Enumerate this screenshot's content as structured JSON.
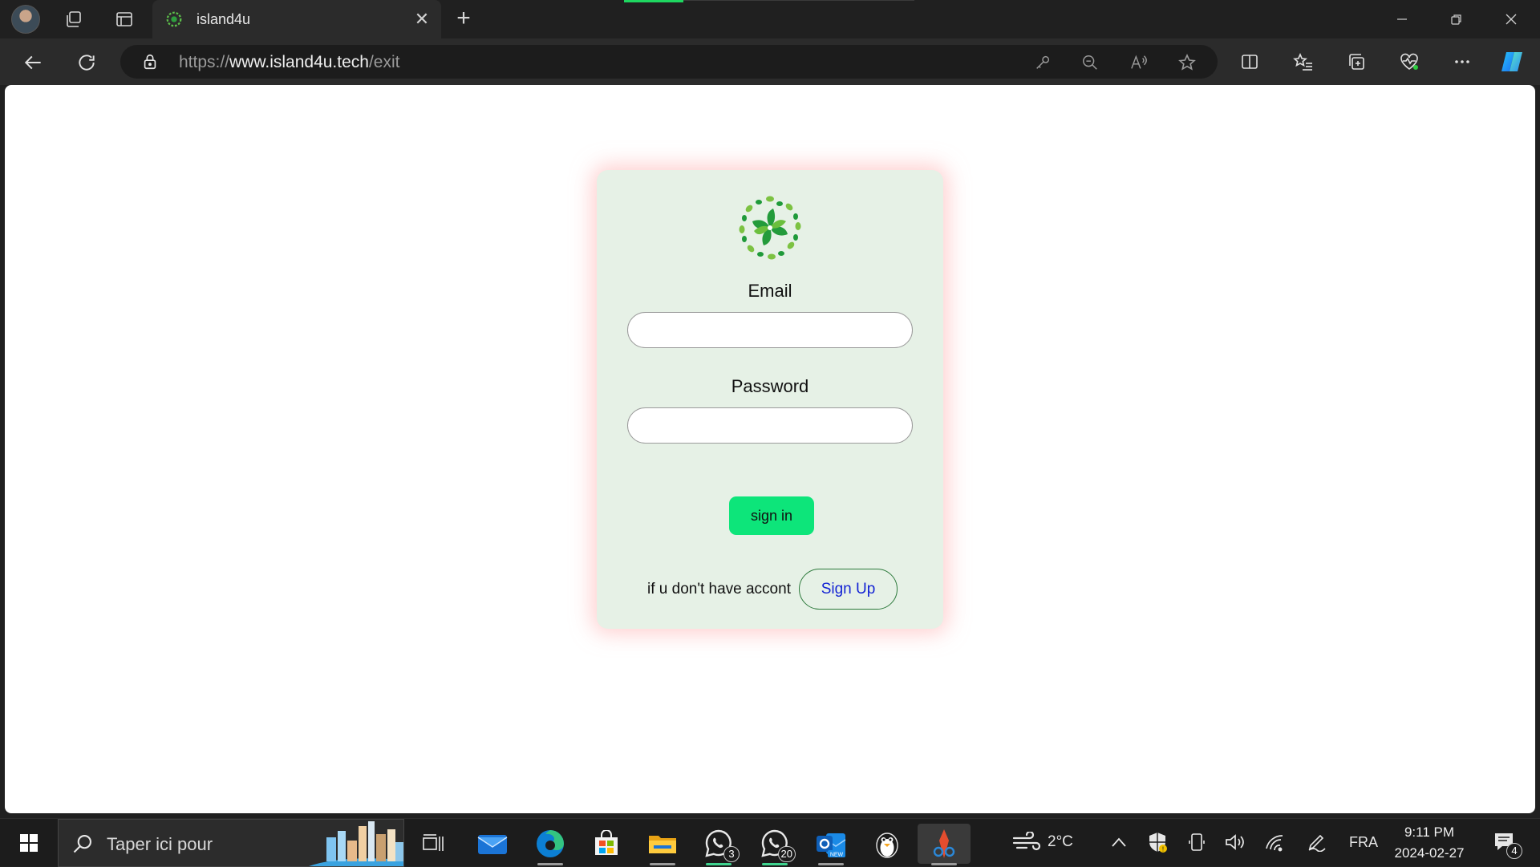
{
  "browser": {
    "tab_title": "island4u",
    "url_scheme": "https://",
    "url_host": "www.island4u.tech",
    "url_path": "/exit"
  },
  "form": {
    "email_label": "Email",
    "email_value": "",
    "password_label": "Password",
    "password_value": "",
    "signin_label": "sign in",
    "no_account_hint": "if u don't have accont",
    "signup_label": "Sign Up"
  },
  "taskbar": {
    "search_placeholder": "Taper ici pour",
    "whatsapp_badge": "3",
    "whatsapp_beta_badge": "20",
    "weather": "2°C",
    "language": "FRA",
    "time": "9:11 PM",
    "date": "2024-02-27",
    "notification_count": "4"
  },
  "colors": {
    "accent_green": "#0de57a",
    "card_bg": "#e6f1e6",
    "signup_text": "#1424d4"
  }
}
